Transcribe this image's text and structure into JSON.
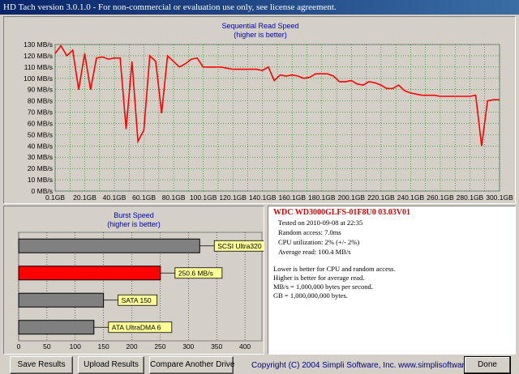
{
  "window": {
    "title": "HD Tach version 3.0.1.0  -  For non-commercial or evaluation use only, see license agreement."
  },
  "read_chart": {
    "title": "Sequential Read Speed",
    "subtitle": "(higher is better)",
    "line_color": "#ff0000",
    "grid_color": "#008000"
  },
  "burst_chart": {
    "title": "Burst Speed",
    "subtitle": "(higher is better)"
  },
  "chart_data": [
    {
      "type": "line",
      "title": "Sequential Read Speed",
      "subtitle": "(higher is better)",
      "y_ticks": [
        "0 MB/s",
        "10 MB/s",
        "20 MB/s",
        "30 MB/s",
        "40 MB/s",
        "50 MB/s",
        "60 MB/s",
        "70 MB/s",
        "80 MB/s",
        "90 MB/s",
        "100 MB/s",
        "110 MB/s",
        "120 MB/s",
        "130 MB/s"
      ],
      "x_ticks": [
        "0.1GB",
        "20.1GB",
        "40.1GB",
        "60.1GB",
        "80.1GB",
        "100.1GB",
        "120.1GB",
        "140.1GB",
        "160.1GB",
        "180.1GB",
        "200.1GB",
        "220.1GB",
        "240.1GB",
        "260.1GB",
        "280.1GB",
        "300.1GB"
      ],
      "xlim": [
        0.1,
        300.1
      ],
      "ylim": [
        0,
        130
      ],
      "grid": true,
      "series": [
        {
          "x": [
            0.1,
            4,
            8,
            12,
            16,
            20,
            24,
            28,
            32,
            36,
            40,
            44,
            48,
            52,
            56,
            60,
            64,
            68,
            72,
            76,
            80,
            84,
            88,
            92,
            96,
            100,
            104,
            108,
            112,
            116,
            120,
            124,
            128,
            132,
            136,
            140,
            144,
            148,
            152,
            156,
            160,
            164,
            168,
            172,
            176,
            180,
            184,
            188,
            192,
            196,
            200,
            204,
            208,
            212,
            216,
            220,
            224,
            228,
            232,
            236,
            240,
            244,
            248,
            252,
            256,
            260,
            264,
            268,
            272,
            276,
            280,
            284,
            288,
            292,
            296,
            300.1
          ],
          "y": [
            122,
            129,
            120,
            125,
            90,
            122,
            90,
            118,
            119,
            117,
            118,
            118,
            55,
            115,
            44,
            54,
            120,
            115,
            69,
            120,
            115,
            110,
            113,
            117,
            118,
            110,
            110,
            110,
            110,
            109,
            108,
            108,
            108,
            108,
            108,
            107,
            110,
            98,
            103,
            102,
            103,
            102,
            100,
            101,
            104,
            104,
            104,
            102,
            97,
            97,
            98,
            95,
            94,
            97,
            96,
            94,
            91,
            91,
            94,
            89,
            87,
            86,
            85,
            85,
            85,
            84,
            84,
            84,
            84,
            84,
            84,
            85,
            40,
            80,
            81,
            81
          ]
        }
      ]
    },
    {
      "type": "bar",
      "title": "Burst Speed",
      "subtitle": "(higher is better)",
      "x_ticks": [
        "0",
        "50",
        "100",
        "150",
        "200",
        "250",
        "300",
        "350",
        "400"
      ],
      "xlim": [
        0,
        430
      ],
      "grid": true,
      "bars": [
        {
          "label": "SCSI Ultra320",
          "value": 320,
          "color": "#808080"
        },
        {
          "label": "250.6 MB/s",
          "value": 250.6,
          "color": "#ff0000"
        },
        {
          "label": "SATA 150",
          "value": 150,
          "color": "#808080"
        },
        {
          "label": "ATA UltraDMA 6",
          "value": 133,
          "color": "#808080"
        }
      ]
    }
  ],
  "info": {
    "drive": "WDC  WD3000GLFS-01F8U0  03.03V01",
    "tested": "Tested on 2010-09-08 at 22:35",
    "random_access": "Random access: 7.0ms",
    "cpu": "CPU utilization: 2% (+/- 2%)",
    "avg_read": "Average read: 100.4 MB/s",
    "note1": "Lower is better for CPU and random access.",
    "note2": "Higher is better for average read.",
    "note3": "MB/s = 1,000,000 bytes per second.",
    "note4": "GB = 1,000,000,000 bytes."
  },
  "buttons": {
    "save": "Save Results",
    "upload": "Upload Results",
    "compare": "Compare Another Drive",
    "done": "Done"
  },
  "copyright": "Copyright (C) 2004 Simpli Software, Inc. www.simplisoftware.com"
}
